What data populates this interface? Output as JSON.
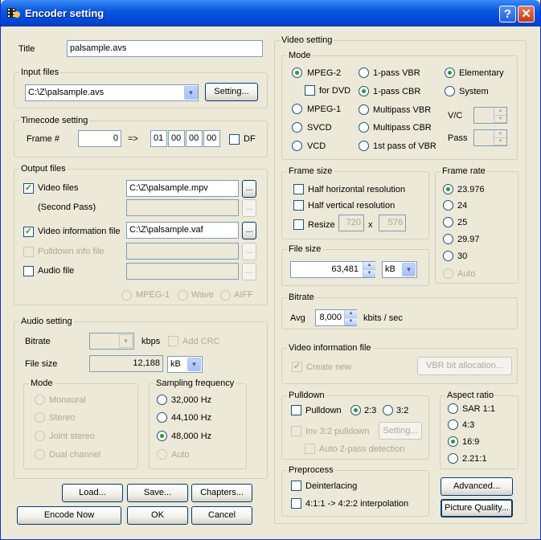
{
  "window": {
    "title": "Encoder setting",
    "help": "?",
    "close": "✕"
  },
  "title_label": "Title",
  "title_value": "palsample.avs",
  "input_files": {
    "legend": "Input files",
    "path": "C:\\Z\\palsample.avs",
    "setting": "Setting..."
  },
  "timecode": {
    "legend": "Timecode setting",
    "frame_label": "Frame #",
    "frame_value": "0",
    "arrow": "=>",
    "hh": "01",
    "mm": "00",
    "ss": "00",
    "ff": "00",
    "df": "DF"
  },
  "output_files": {
    "legend": "Output files",
    "video_files": "Video files",
    "video_path": "C:\\Z\\palsample.mpv",
    "second_pass": "(Second Pass)",
    "video_info": "Video information file",
    "vaf_path": "C:\\Z\\palsample.vaf",
    "pulldown_info": "Pulldown info file",
    "audio_file": "Audio file",
    "mpeg1": "MPEG-1",
    "wave": "Wave",
    "aiff": "AIFF",
    "browse": "..."
  },
  "audio": {
    "legend": "Audio setting",
    "bitrate": "Bitrate",
    "kbps": "kbps",
    "add_crc": "Add CRC",
    "file_size": "File size",
    "file_size_value": "12,188",
    "unit": "kB",
    "mode_legend": "Mode",
    "modes": [
      "Monaural",
      "Stereo",
      "Joint stereo",
      "Dual channel"
    ],
    "freq_legend": "Sampling frequency",
    "freqs": [
      "32,000 Hz",
      "44,100 Hz",
      "48,000 Hz",
      "Auto"
    ]
  },
  "buttons": {
    "load": "Load...",
    "save": "Save...",
    "chapters": "Chapters...",
    "encode": "Encode Now",
    "ok": "OK",
    "cancel": "Cancel",
    "advanced": "Advanced...",
    "picture": "Picture Quality..."
  },
  "video": {
    "legend": "Video setting",
    "mode_legend": "Mode",
    "mpeg2": "MPEG-2",
    "for_dvd": "for DVD",
    "mpeg1": "MPEG-1",
    "svcd": "SVCD",
    "vcd": "VCD",
    "vbr1": "1-pass VBR",
    "cbr1": "1-pass CBR",
    "mvbr": "Multipass VBR",
    "mcbr": "Multipass CBR",
    "first_pass": "1st pass of VBR",
    "elementary": "Elementary",
    "system": "System",
    "vc": "V/C",
    "pass": "Pass"
  },
  "frame_size": {
    "legend": "Frame size",
    "half_h": "Half horizontal resolution",
    "half_v": "Half vertical resolution",
    "resize": "Resize",
    "w": "720",
    "x": "x",
    "h": "576"
  },
  "frame_rate": {
    "legend": "Frame rate",
    "rates": [
      "23.976",
      "24",
      "25",
      "29.97",
      "30",
      "Auto"
    ]
  },
  "file_size": {
    "legend": "File size",
    "value": "63,481",
    "unit": "kB"
  },
  "bitrate": {
    "legend": "Bitrate",
    "avg": "Avg",
    "value": "8,000",
    "unit": "kbits / sec"
  },
  "vinfo": {
    "legend": "Video information file",
    "create_new": "Create new",
    "vbr_alloc": "VBR bit allocation..."
  },
  "pulldown": {
    "legend": "Pulldown",
    "pulldown": "Pulldown",
    "r23": "2:3",
    "r32": "3:2",
    "inv": "Inv 3:2 pulldown",
    "setting": "Setting...",
    "auto2": "Auto 2-pass detection"
  },
  "aspect": {
    "legend": "Aspect ratio",
    "ratios": [
      "SAR 1:1",
      "4:3",
      "16:9",
      "2.21:1"
    ]
  },
  "preprocess": {
    "legend": "Preprocess",
    "deinterlacing": "Deinterlacing",
    "interp": "4:1:1 -> 4:2:2 interpolation"
  }
}
